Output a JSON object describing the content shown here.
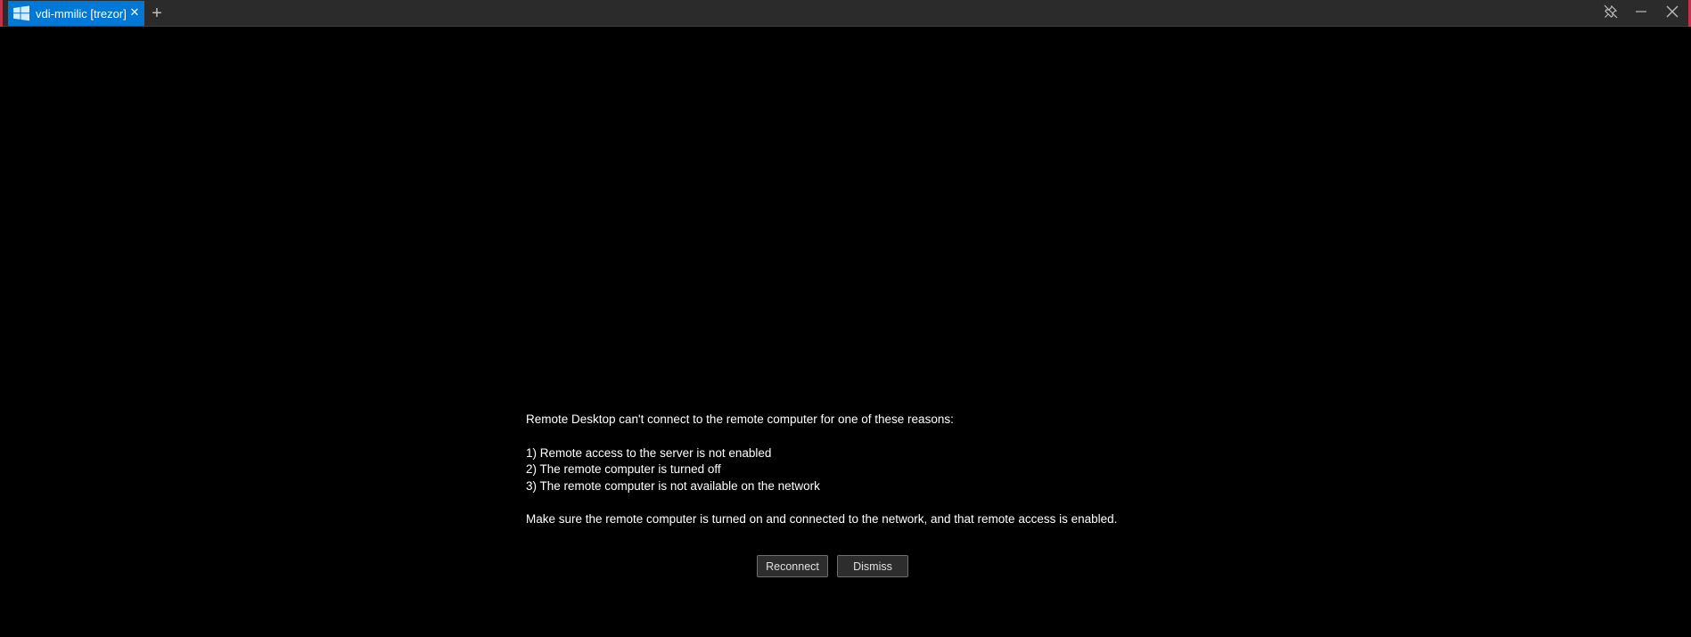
{
  "titlebar": {
    "tabs": [
      {
        "label": "vdi-mmilic [trezor]",
        "icon": "windows-icon",
        "close_glyph": "✕",
        "active": true
      }
    ],
    "new_tab_glyph": "+",
    "controls": {
      "pin_icon": "pin-icon",
      "minimize_icon": "minimize-icon",
      "close_icon": "close-icon"
    }
  },
  "message": {
    "heading": "Remote Desktop can't connect to the remote computer for one of these reasons:",
    "reasons": [
      "1) Remote access to the server is not enabled",
      "2) The remote computer is turned off",
      "3) The remote computer is not available on the network"
    ],
    "footer": "Make sure the remote computer is turned on and connected to the network, and that remote access is enabled."
  },
  "actions": {
    "reconnect_label": "Reconnect",
    "dismiss_label": "Dismiss"
  },
  "colors": {
    "accent": "#0078d7",
    "titlebar": "#2b2b2b",
    "background": "#000000",
    "window_edge": "#c4314b"
  }
}
